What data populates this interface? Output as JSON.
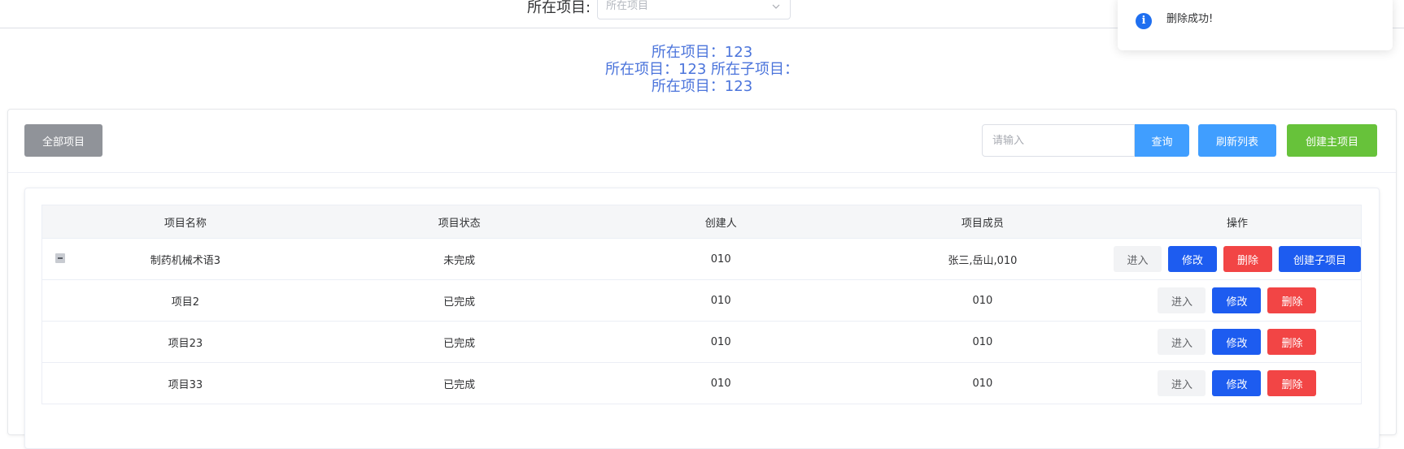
{
  "topbar": {
    "label": "所在项目:",
    "select_placeholder": "所在项目"
  },
  "info_lines": [
    "所在项目：123",
    "所在项目：123 所在子项目：",
    "所在项目：123"
  ],
  "toast": {
    "message": "删除成功!"
  },
  "toolbar": {
    "all_projects": "全部项目",
    "search_placeholder": "请输入",
    "query": "查询",
    "refresh": "刷新列表",
    "create_main": "创建主项目"
  },
  "table": {
    "headers": [
      "项目名称",
      "项目状态",
      "创建人",
      "项目成员",
      "操作"
    ],
    "rows": [
      {
        "name": "制药机械术语3",
        "status": "未完成",
        "creator": "010",
        "members": "张三,岳山,010"
      },
      {
        "name": "项目2",
        "status": "已完成",
        "creator": "010",
        "members": "010"
      },
      {
        "name": "项目23",
        "status": "已完成",
        "creator": "010",
        "members": "010"
      },
      {
        "name": "项目33",
        "status": "已完成",
        "creator": "010",
        "members": "010"
      }
    ],
    "actions": {
      "enter": "进入",
      "edit": "修改",
      "delete": "删除",
      "create_child": "创建子项目"
    }
  }
}
